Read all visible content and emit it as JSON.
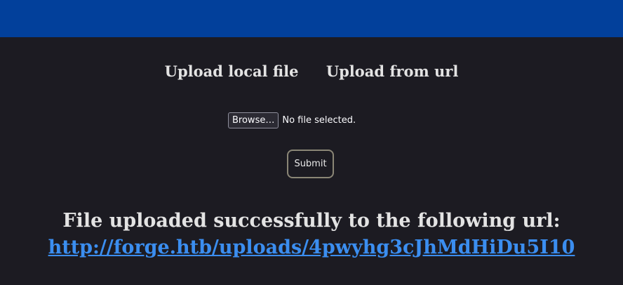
{
  "header": {
    "color": "#02409b"
  },
  "tabs": [
    {
      "label": "Upload local file"
    },
    {
      "label": "Upload from url"
    }
  ],
  "file_input": {
    "button_label": "Browse…",
    "status": "No file selected."
  },
  "form": {
    "submit_label": "Submit"
  },
  "result": {
    "message": "File uploaded successfully to the following url:",
    "url": "http://forge.htb/uploads/4pwyhg3cJhMdHiDu5I10"
  },
  "colors": {
    "background": "#1c1b22",
    "link": "#3b8ef0"
  }
}
